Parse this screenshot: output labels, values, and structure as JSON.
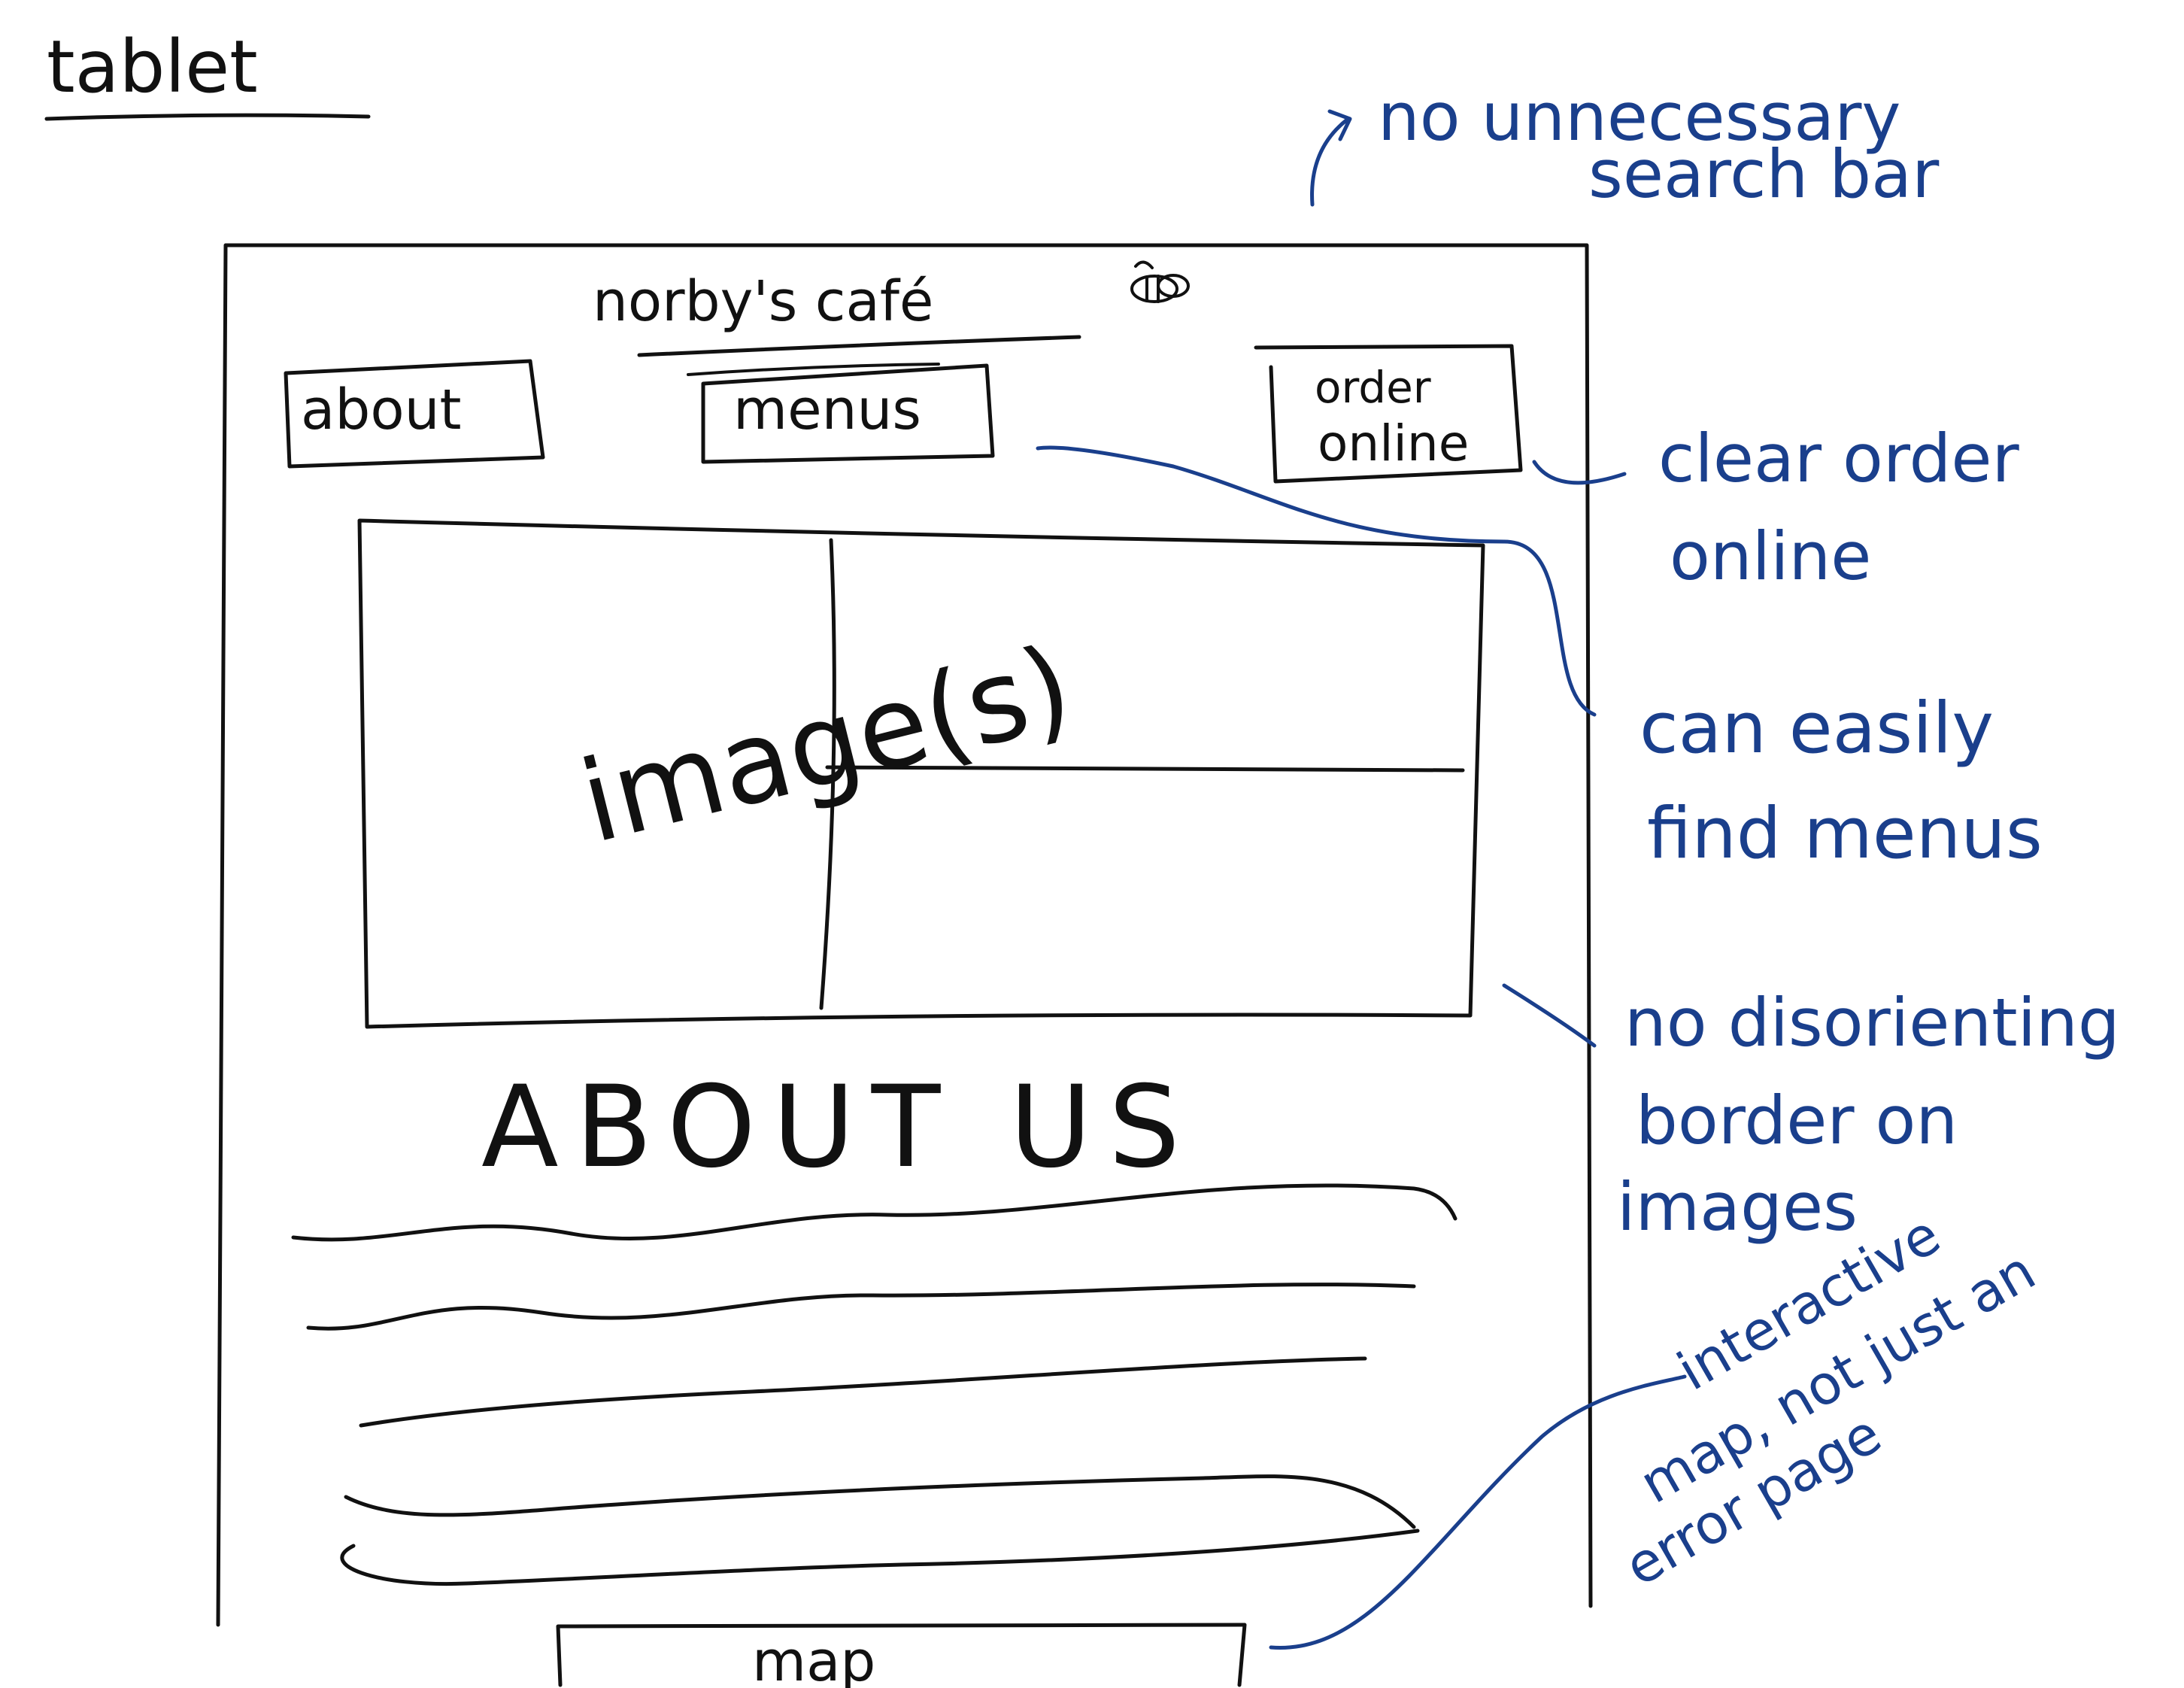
{
  "title": "tablet",
  "site": {
    "name": "norby's café",
    "nav": {
      "about": "about",
      "menus": "menus",
      "order_line1": "order",
      "order_line2": "online"
    },
    "images_label": "image(s)",
    "about_heading": "ABOUT US",
    "map_label": "map"
  },
  "notes": {
    "search_1": "no unnecessary",
    "search_2": "search bar",
    "order_1": "clear order",
    "order_2": "online",
    "menus_1": "can easily",
    "menus_2": "find menus",
    "border_1": "no disorienting",
    "border_2": "border on",
    "border_3": "images",
    "map_1": "interactive",
    "map_2": "map, not just an",
    "map_3": "error page"
  },
  "colors": {
    "ink": "#111111",
    "annotation": "#1a3f8c",
    "paper": "#ffffff"
  }
}
